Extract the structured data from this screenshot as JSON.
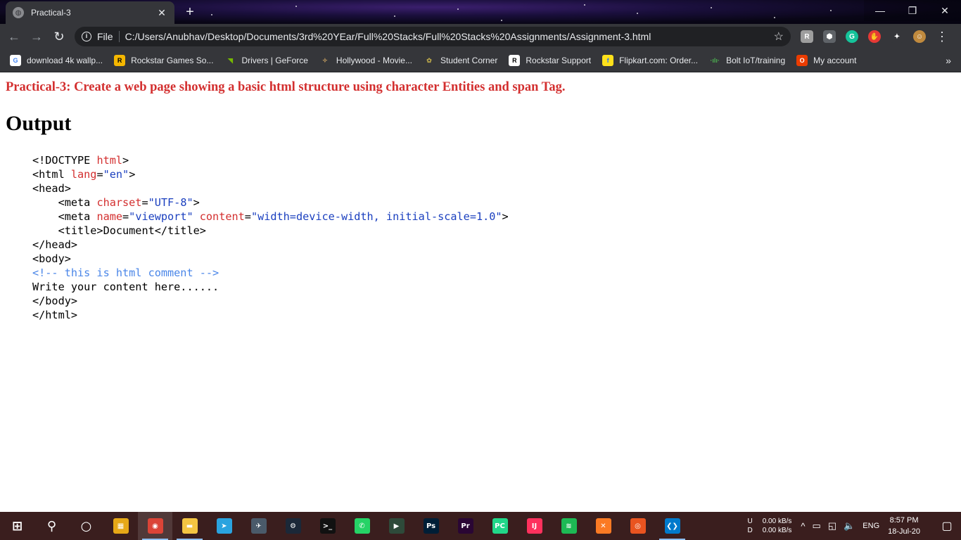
{
  "browser": {
    "tab": {
      "title": "Practical-3",
      "close": "✕"
    },
    "new_tab": "+",
    "window_controls": {
      "minimize": "—",
      "maximize": "❐",
      "close": "✕"
    },
    "nav": {
      "back": "←",
      "forward": "→",
      "reload": "↻"
    },
    "omnibox": {
      "scheme": "File",
      "url": "C:/Users/Anubhav/Desktop/Documents/3rd%20YEar/Full%20Stacks/Full%20Stacks%20Assignments/Assignment-3.html",
      "star": "☆"
    },
    "extensions": [
      {
        "name": "ext-r-icon",
        "glyph": "R",
        "color": "#9e9e9e"
      },
      {
        "name": "ext-puzzle-cube-icon",
        "glyph": "⬢",
        "color": "#5f6368"
      },
      {
        "name": "grammarly-icon",
        "glyph": "G",
        "color": "#15c39a"
      },
      {
        "name": "adblock-hand-icon",
        "glyph": "✋",
        "color": "#e53935"
      },
      {
        "name": "extensions-puzzle-icon",
        "glyph": "✦",
        "color": "#35363a"
      },
      {
        "name": "profile-avatar",
        "glyph": "☺",
        "color": "#c08a3e"
      }
    ],
    "menu": "⋮"
  },
  "bookmarks": {
    "items": [
      {
        "label": "download 4k wallp...",
        "icon": "google-icon",
        "glyph": "G",
        "color": "#ffffff",
        "fg": "#4285f4"
      },
      {
        "label": "Rockstar Games So...",
        "icon": "rockstar-icon",
        "glyph": "R",
        "color": "#f5b700",
        "fg": "#000000"
      },
      {
        "label": "Drivers | GeForce",
        "icon": "nvidia-icon",
        "glyph": "◥",
        "color": "#35363a",
        "fg": "#76b900"
      },
      {
        "label": "Hollywood - Movie...",
        "icon": "hollywood-icon",
        "glyph": "✧",
        "color": "#35363a",
        "fg": "#c8a060"
      },
      {
        "label": "Student Corner",
        "icon": "student-corner-icon",
        "glyph": "✿",
        "color": "#35363a",
        "fg": "#b7a44a"
      },
      {
        "label": "Rockstar Support",
        "icon": "rockstar-support-icon",
        "glyph": "R",
        "color": "#ffffff",
        "fg": "#000000"
      },
      {
        "label": "Flipkart.com: Order...",
        "icon": "flipkart-icon",
        "glyph": "f",
        "color": "#ffe11b",
        "fg": "#2874f0"
      },
      {
        "label": "Bolt IoT/training",
        "icon": "bolt-iot-icon",
        "glyph": "·ılı·",
        "color": "#35363a",
        "fg": "#4caf50"
      },
      {
        "label": "My account",
        "icon": "office-icon",
        "glyph": "O",
        "color": "#eb3c00",
        "fg": "#ffffff"
      }
    ],
    "more": "»"
  },
  "page": {
    "heading": "Practical-3: Create a web page showing a basic html structure using character Entities and span Tag.",
    "output_title": "Output",
    "code_lines": [
      [
        {
          "t": "<!DOCTYPE ",
          "c": ""
        },
        {
          "t": "html",
          "c": "kw"
        },
        {
          "t": ">",
          "c": ""
        }
      ],
      [
        {
          "t": "<html ",
          "c": ""
        },
        {
          "t": "lang",
          "c": "kw"
        },
        {
          "t": "=",
          "c": ""
        },
        {
          "t": "\"en\"",
          "c": "str"
        },
        {
          "t": ">",
          "c": ""
        }
      ],
      [
        {
          "t": "<head>",
          "c": ""
        }
      ],
      [
        {
          "t": "    <meta ",
          "c": ""
        },
        {
          "t": "charset",
          "c": "kw"
        },
        {
          "t": "=",
          "c": ""
        },
        {
          "t": "\"UTF-8\"",
          "c": "str"
        },
        {
          "t": ">",
          "c": ""
        }
      ],
      [
        {
          "t": "    <meta ",
          "c": ""
        },
        {
          "t": "name",
          "c": "kw"
        },
        {
          "t": "=",
          "c": ""
        },
        {
          "t": "\"viewport\"",
          "c": "str"
        },
        {
          "t": " ",
          "c": ""
        },
        {
          "t": "content",
          "c": "kw"
        },
        {
          "t": "=",
          "c": ""
        },
        {
          "t": "\"width=device-width, initial-scale=1.0\"",
          "c": "str"
        },
        {
          "t": ">",
          "c": ""
        }
      ],
      [
        {
          "t": "    <title>Document</title>",
          "c": ""
        }
      ],
      [
        {
          "t": "</head>",
          "c": ""
        }
      ],
      [
        {
          "t": "<body>",
          "c": ""
        }
      ],
      [
        {
          "t": "<!-- this is html comment -->",
          "c": "cm"
        }
      ],
      [
        {
          "t": "Write your content here......",
          "c": ""
        }
      ],
      [
        {
          "t": "</body>",
          "c": ""
        }
      ],
      [
        {
          "t": "</html>",
          "c": ""
        }
      ]
    ]
  },
  "taskbar": {
    "apps": [
      {
        "name": "start-button",
        "icon": "windows-logo-icon",
        "glyph": "⊞",
        "color": "transparent"
      },
      {
        "name": "search-button",
        "icon": "search-icon",
        "glyph": "⚲",
        "color": "transparent"
      },
      {
        "name": "cortana-button",
        "icon": "cortana-circle-icon",
        "glyph": "○",
        "color": "transparent"
      },
      {
        "name": "taskbar-store",
        "icon": "store-icon",
        "glyph": "▦",
        "color": "#e6a817"
      },
      {
        "name": "taskbar-chrome",
        "icon": "chrome-icon",
        "glyph": "◉",
        "color": "#db4437",
        "active": true
      },
      {
        "name": "taskbar-file-explorer",
        "icon": "folder-icon",
        "glyph": "▬",
        "color": "#f4c542",
        "running": true
      },
      {
        "name": "taskbar-telegram",
        "icon": "telegram-icon",
        "glyph": "➤",
        "color": "#2aa3df"
      },
      {
        "name": "taskbar-game",
        "icon": "game-icon",
        "glyph": "✈",
        "color": "#4a5a6a"
      },
      {
        "name": "taskbar-steam",
        "icon": "steam-icon",
        "glyph": "⚙",
        "color": "#1b2838"
      },
      {
        "name": "taskbar-terminal",
        "icon": "terminal-icon",
        "glyph": ">_",
        "color": "#111111"
      },
      {
        "name": "taskbar-whatsapp",
        "icon": "whatsapp-icon",
        "glyph": "✆",
        "color": "#25d366"
      },
      {
        "name": "taskbar-app",
        "icon": "app-arrow-icon",
        "glyph": "▶",
        "color": "#2e4a3a"
      },
      {
        "name": "taskbar-photoshop",
        "icon": "photoshop-icon",
        "glyph": "Ps",
        "color": "#001e36"
      },
      {
        "name": "taskbar-premiere",
        "icon": "premiere-icon",
        "glyph": "Pr",
        "color": "#2a0634"
      },
      {
        "name": "taskbar-pycharm",
        "icon": "pycharm-icon",
        "glyph": "PC",
        "color": "#21d789"
      },
      {
        "name": "taskbar-intellij",
        "icon": "intellij-icon",
        "glyph": "IJ",
        "color": "#fe315d"
      },
      {
        "name": "taskbar-spotify",
        "icon": "spotify-icon",
        "glyph": "≋",
        "color": "#1db954"
      },
      {
        "name": "taskbar-xampp",
        "icon": "xampp-icon",
        "glyph": "✕",
        "color": "#fb7a24"
      },
      {
        "name": "taskbar-ubuntu",
        "icon": "ubuntu-icon",
        "glyph": "◎",
        "color": "#e95420"
      },
      {
        "name": "taskbar-vscode",
        "icon": "vscode-icon",
        "glyph": "❮❯",
        "color": "#007acc",
        "running": true
      }
    ],
    "tray": {
      "net_up_label": "U",
      "net_down_label": "D",
      "net_up": "0.00 kB/s",
      "net_down": "0.00 kB/s",
      "chevron": "^",
      "battery": "▭",
      "network": "◱",
      "volume": "🔈",
      "language": "ENG",
      "time": "8:57 PM",
      "date": "18-Jul-20",
      "notifications": "▢"
    }
  }
}
